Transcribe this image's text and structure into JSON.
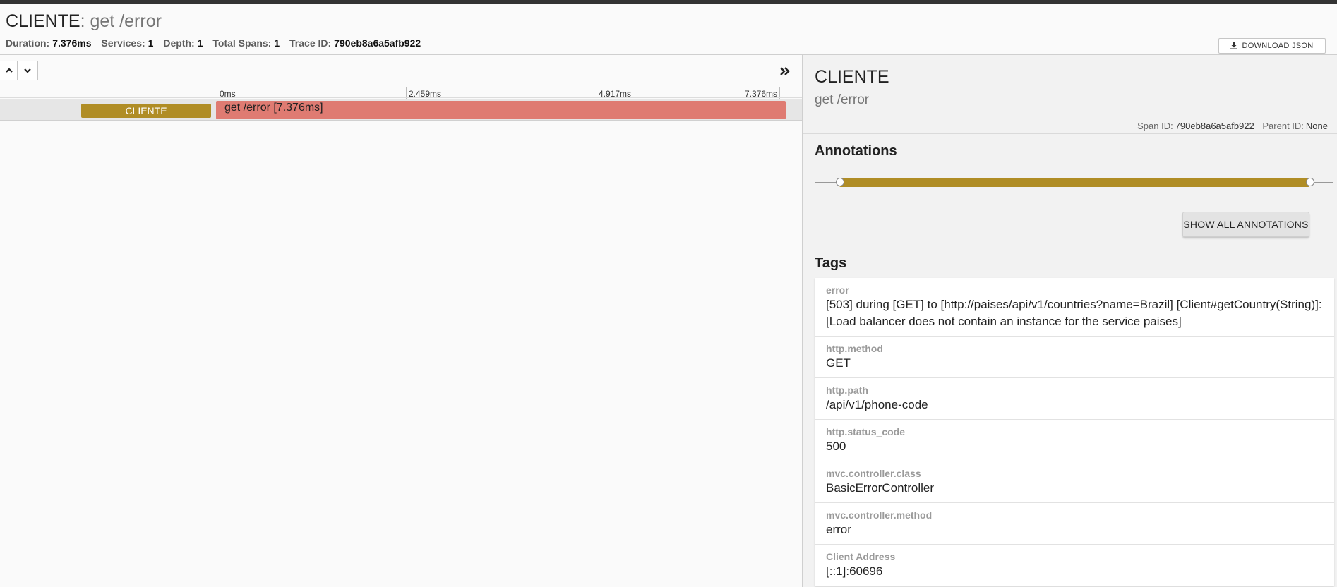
{
  "header": {
    "service": "CLIENTE",
    "separator": ":",
    "operation": "get /error",
    "stats": [
      {
        "label": "Duration:",
        "value": "7.376ms"
      },
      {
        "label": "Services:",
        "value": "1"
      },
      {
        "label": "Depth:",
        "value": "1"
      },
      {
        "label": "Total Spans:",
        "value": "1"
      },
      {
        "label": "Trace ID:",
        "value": "790eb8a6a5afb922"
      }
    ],
    "download_label": "DOWNLOAD JSON"
  },
  "timeline": {
    "ticks": [
      "0ms",
      "2.459ms",
      "4.917ms",
      "7.376ms"
    ],
    "span": {
      "service": "CLIENTE",
      "label": "get /error [7.376ms]",
      "color": "#df7b72",
      "service_color": "#b08d25"
    }
  },
  "detail": {
    "service": "CLIENTE",
    "operation": "get /error",
    "span_id_label": "Span ID:",
    "span_id": "790eb8a6a5afb922",
    "parent_id_label": "Parent ID:",
    "parent_id": "None",
    "annotations_title": "Annotations",
    "show_all_label": "SHOW ALL ANNOTATIONS",
    "tags_title": "Tags",
    "tags": [
      {
        "key": "error",
        "value": "[503] during [GET] to [http://paises/api/v1/countries?name=Brazil] [Client#getCountry(String)]: [Load balancer does not contain an instance for the service paises]"
      },
      {
        "key": "http.method",
        "value": "GET"
      },
      {
        "key": "http.path",
        "value": "/api/v1/phone-code"
      },
      {
        "key": "http.status_code",
        "value": "500"
      },
      {
        "key": "mvc.controller.class",
        "value": "BasicErrorController"
      },
      {
        "key": "mvc.controller.method",
        "value": "error"
      },
      {
        "key": "Client Address",
        "value": "[::1]:60696"
      }
    ]
  },
  "colors": {
    "accent": "#b08d25",
    "span": "#df7b72"
  }
}
